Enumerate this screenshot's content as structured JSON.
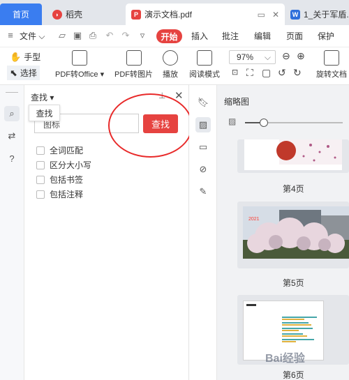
{
  "tabs": {
    "home": "首页",
    "daoke": "稻壳",
    "doc": "演示文档.pdf",
    "w": "1_关于军盾."
  },
  "menu": {
    "file": "文件",
    "start": "开始",
    "insert": "插入",
    "comment": "批注",
    "edit": "编辑",
    "page": "页面",
    "protect": "保护"
  },
  "toolbar": {
    "hand": "手型",
    "select": "选择",
    "pdf_to_office": "PDF转Office",
    "pdf_to_image": "PDF转图片",
    "play": "播放",
    "read_mode": "阅读模式",
    "zoom": "97%",
    "rotate": "旋转文档"
  },
  "search_panel": {
    "title": "查找",
    "tooltip": "查找",
    "input_value": "图标",
    "find_button": "查找",
    "options": [
      "全词匹配",
      "区分大小写",
      "包括书签",
      "包括注释"
    ]
  },
  "thumbnails": {
    "title": "缩略图",
    "slider_fraction": 0.19,
    "pages": [
      "第4页",
      "第5页",
      "第6页"
    ],
    "page5_year": "2021"
  },
  "colors": {
    "accent_blue": "#3a7df0",
    "accent_red": "#e64340"
  },
  "watermark": "Bai经验"
}
